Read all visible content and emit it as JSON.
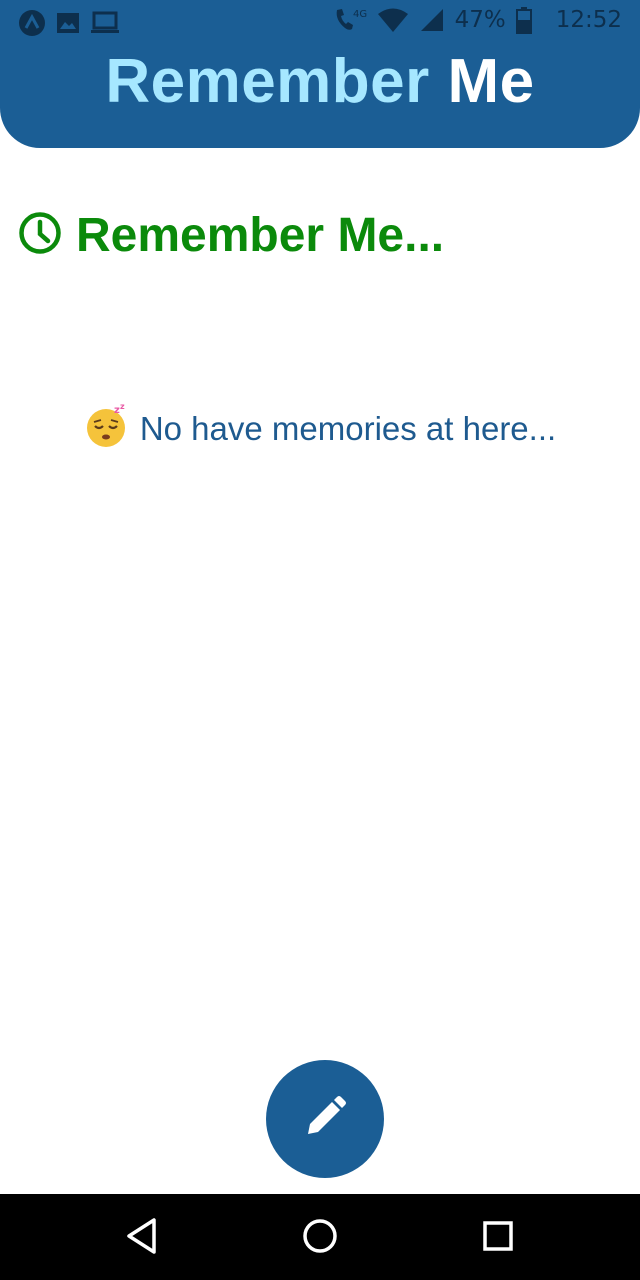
{
  "status_bar": {
    "left_icons": [
      "app-a-icon",
      "image-icon",
      "laptop-icon"
    ],
    "right_icons": [
      "wifi-call-icon",
      "wifi-icon",
      "signal-icon",
      "battery-icon"
    ],
    "network_label": "4G",
    "battery_percent": "47%",
    "time": "12:52"
  },
  "header": {
    "title_part1": "Remember",
    "title_part2": "Me"
  },
  "section": {
    "icon": "clock-icon",
    "title": "Remember Me..."
  },
  "empty_state": {
    "emoji": "sleeping-face-icon",
    "message": "No have memories at here..."
  },
  "fab": {
    "icon": "pencil-icon"
  },
  "nav": {
    "buttons": [
      "back-icon",
      "home-icon",
      "recents-icon"
    ]
  },
  "colors": {
    "primary": "#1b5e95",
    "title_light": "#a6e7ff",
    "section_green": "#0b8a0b",
    "empty_text": "#1e5a8f"
  }
}
